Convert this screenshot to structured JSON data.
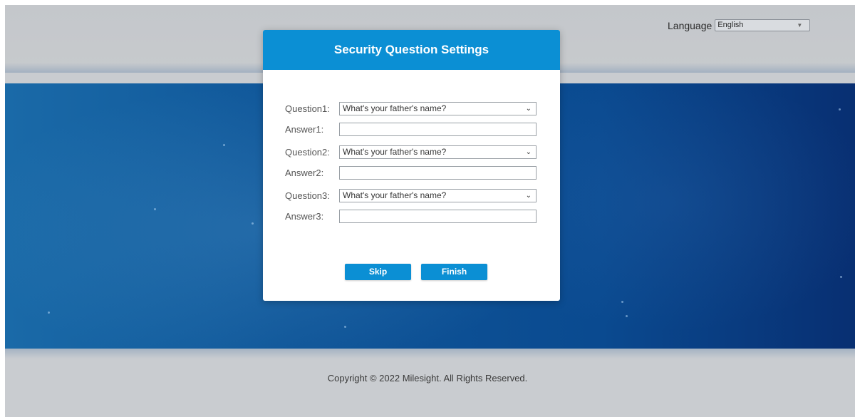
{
  "language": {
    "label": "Language",
    "selected": "English"
  },
  "dialog": {
    "title": "Security Question Settings",
    "rows": [
      {
        "question_label": "Question1:",
        "question_value": "What's your father's name?",
        "answer_label": "Answer1:",
        "answer_value": ""
      },
      {
        "question_label": "Question2:",
        "question_value": "What's your father's name?",
        "answer_label": "Answer2:",
        "answer_value": ""
      },
      {
        "question_label": "Question3:",
        "question_value": "What's your father's name?",
        "answer_label": "Answer3:",
        "answer_value": ""
      }
    ],
    "skip_label": "Skip",
    "finish_label": "Finish"
  },
  "footer": {
    "copyright": "Copyright © 2022 Milesight. All Rights Reserved."
  },
  "colors": {
    "accent": "#0b8fd4",
    "band_blue": "#0f5598"
  }
}
